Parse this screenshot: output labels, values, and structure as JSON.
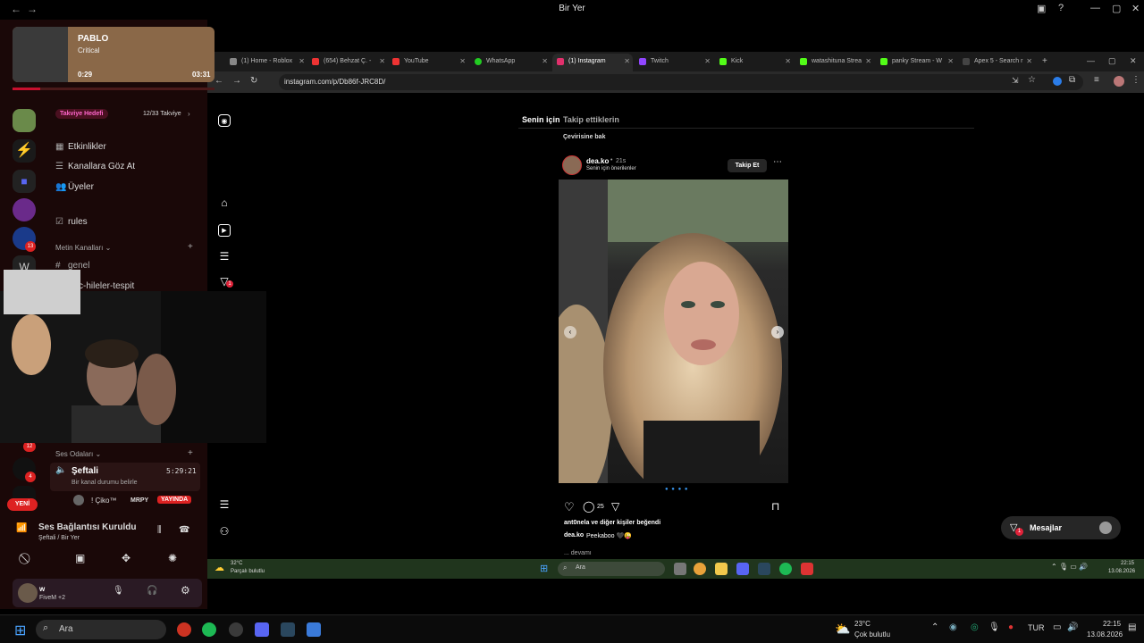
{
  "window": {
    "title": "Bir Yer"
  },
  "media_overlay": {
    "artist": "PABLO",
    "track": "Critical",
    "elapsed": "0:29",
    "duration": "03:31",
    "progress": 0.137
  },
  "browser": {
    "tabs": [
      {
        "label": "(1) Home - Roblox",
        "color": "#999"
      },
      {
        "label": "(654) Behzat Ç. -",
        "color": "#e33"
      },
      {
        "label": "YouTube",
        "color": "#e33"
      },
      {
        "label": "WhatsApp",
        "color": "#2c2"
      },
      {
        "label": "(1) Instagram",
        "color": "#e1306c",
        "active": true
      },
      {
        "label": "Twitch",
        "color": "#9146ff"
      },
      {
        "label": "Kick",
        "color": "#53fc18"
      },
      {
        "label": "watashituna Strea",
        "color": "#53fc18"
      },
      {
        "label": "panky Stream - W",
        "color": "#53fc18"
      },
      {
        "label": "Apex 5 - Search r",
        "color": "#444"
      }
    ],
    "url": "instagram.com/p/Db86f-JRC8D/"
  },
  "instagram": {
    "feed_tabs": [
      "Senin için",
      "Takip ettiklerin"
    ],
    "translate_link": "Çevirisine bak",
    "post": {
      "username": "dea.ko",
      "time": "21s",
      "subtitle": "Senin için önerilenler",
      "follow_label": "Takip Et",
      "comment_count": "25",
      "liked_by": "ant0nela ve diğer kişiler beğendi",
      "caption_user": "dea.ko",
      "caption": "Peekaboo 🖤😜",
      "more": "... devamı"
    },
    "messages_label": "Mesajlar",
    "messages_badge": "1"
  },
  "discord": {
    "boost_label": "Takviye Hedefi",
    "boost_count": "12/33 Takviye",
    "channels": {
      "events": "Etkinlikler",
      "browse": "Kanallara Göz At",
      "members": "Üyeler",
      "rules": "rules",
      "text_category": "Metin Kanalları",
      "general": "genel",
      "cheats": "c-hileler-tespit"
    },
    "voice_category": "Ses Odaları",
    "voice_channel": "Şeftali",
    "voice_timer": "5:29:21",
    "voice_status": "Bir kanal durumu belirle",
    "voice_user1": "! Çiko™",
    "voice_user2": "MRPY",
    "live_badge": "YAYINDA",
    "new_badge": "YENİ",
    "connection_title": "Ses Bağlantısı Kuruldu",
    "connection_sub": "Şeftali / Bir Yer",
    "user_name": "w",
    "user_status": "FiveM +2",
    "guild_badges": [
      "13",
      "12",
      "4"
    ]
  },
  "inner_taskbar": {
    "weather_temp": "32°C",
    "weather_desc": "Parçalı bulutlu",
    "search": "Ara",
    "time": "22:15",
    "date": "13.08.2026"
  },
  "taskbar": {
    "search": "Ara",
    "weather_temp": "23°C",
    "weather_desc": "Çok bulutlu",
    "lang": "TUR",
    "time": "22:15",
    "date": "13.08.2026"
  },
  "colors": {
    "discord_bg": "#1a0808",
    "accent_red": "#c8102e",
    "ig_bg": "#000000",
    "taskbar_green": "#20351d"
  }
}
